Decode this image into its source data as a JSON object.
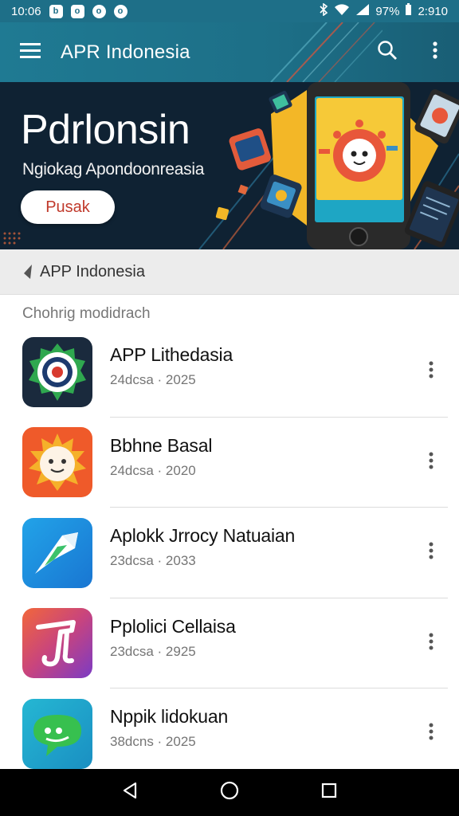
{
  "status_bar": {
    "time": "10:06",
    "notification_icons": [
      "b",
      "o",
      "o",
      "o"
    ],
    "battery": "97%",
    "right_time": "2:910"
  },
  "app_bar": {
    "title": "APR Indonesia",
    "menu_icon": "hamburger-icon",
    "search_icon": "search-icon",
    "more_icon": "more-vert-icon"
  },
  "banner": {
    "title": "Pdrlonsin",
    "subtitle": "Ngiokag Apondoonreasia",
    "button_label": "Pusak"
  },
  "breadcrumb": {
    "text": "APP Indonesia",
    "icon": "back-arrow-icon"
  },
  "section": {
    "label": "Chohrig modidrach"
  },
  "apps": [
    {
      "name": "APP Lithedasia",
      "meta": "24dcsa · 2025",
      "icon": "target-badge-icon"
    },
    {
      "name": "Bbhne Basal",
      "meta": "24dcsa · 2020",
      "icon": "sun-face-icon"
    },
    {
      "name": "Aplokk Jrrocy Natuaian",
      "meta": "23dcsa · 2033",
      "icon": "arrow-plane-icon"
    },
    {
      "name": "Pplolici Cellaisa",
      "meta": "23dcsa · 2925",
      "icon": "music-note-icon"
    },
    {
      "name": "Nppik lidokuan",
      "meta": "38dcns · 2025",
      "icon": "chat-bubble-icon"
    }
  ],
  "colors": {
    "primary": "#1e6f88",
    "banner_bg": "#0f2233",
    "accent_red": "#c0392b",
    "divider": "#dcdcdc"
  }
}
